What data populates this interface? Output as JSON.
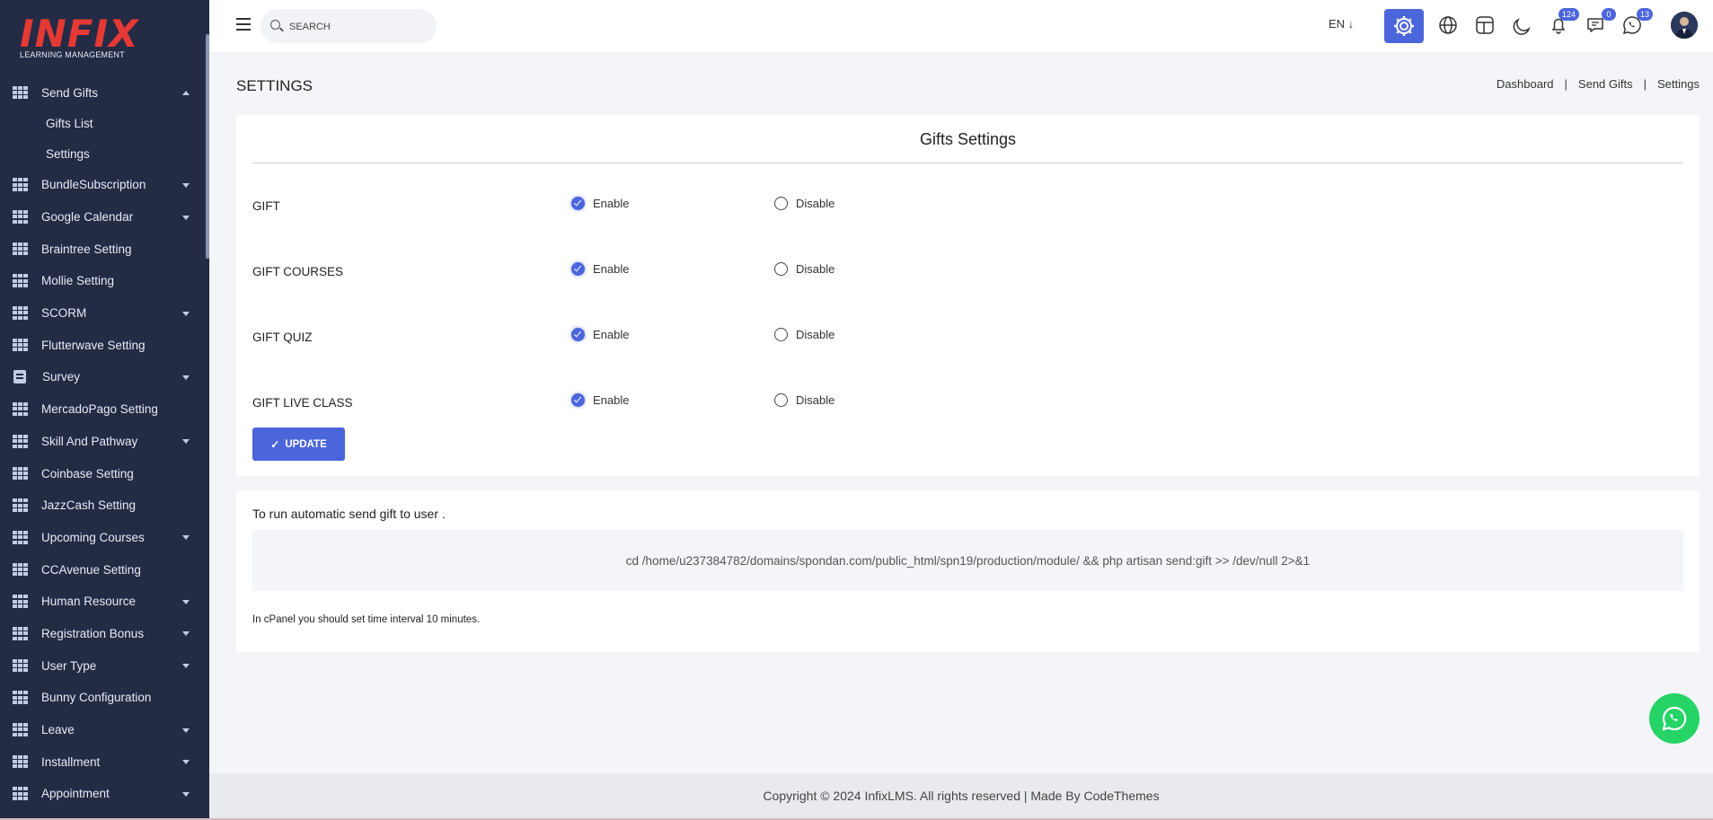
{
  "sidebar": {
    "logo_text": "INFIX",
    "logo_sub": "LEARNING MANAGEMENT",
    "active_group": "Send Gifts",
    "sub_items": [
      "Gifts List",
      "Settings"
    ],
    "items": [
      {
        "label": "BundleSubscription",
        "caret": true
      },
      {
        "label": "Google Calendar",
        "caret": true
      },
      {
        "label": "Braintree Setting",
        "caret": false
      },
      {
        "label": "Mollie Setting",
        "caret": false
      },
      {
        "label": "SCORM",
        "caret": true
      },
      {
        "label": "Flutterwave Setting",
        "caret": false
      },
      {
        "label": "Survey",
        "caret": true
      },
      {
        "label": "MercadoPago Setting",
        "caret": false
      },
      {
        "label": "Skill And Pathway",
        "caret": true
      },
      {
        "label": "Coinbase Setting",
        "caret": false
      },
      {
        "label": "JazzCash Setting",
        "caret": false
      },
      {
        "label": "Upcoming Courses",
        "caret": true
      },
      {
        "label": "CCAvenue Setting",
        "caret": false
      },
      {
        "label": "Human Resource",
        "caret": true
      },
      {
        "label": "Registration Bonus",
        "caret": true
      },
      {
        "label": "User Type",
        "caret": true
      },
      {
        "label": "Bunny Configuration",
        "caret": false
      },
      {
        "label": "Leave",
        "caret": true
      },
      {
        "label": "Installment",
        "caret": true
      },
      {
        "label": "Appointment",
        "caret": true
      }
    ]
  },
  "header": {
    "search_placeholder": "SEARCH",
    "language": "EN ↓",
    "badges": {
      "notifications": "124",
      "messages": "0",
      "whatsapp": "13"
    }
  },
  "page": {
    "title": "SETTINGS",
    "breadcrumb": [
      "Dashboard",
      "Send Gifts",
      "Settings"
    ]
  },
  "settings_card": {
    "title": "Gifts Settings",
    "enable_label": "Enable",
    "disable_label": "Disable",
    "rows": [
      {
        "label": "GIFT",
        "value": "Enable"
      },
      {
        "label": "GIFT COURSES",
        "value": "Enable"
      },
      {
        "label": "GIFT QUIZ",
        "value": "Enable"
      },
      {
        "label": "GIFT LIVE CLASS",
        "value": "Enable"
      }
    ],
    "update_label": "UPDATE"
  },
  "cron_card": {
    "title": "To run automatic send gift to user .",
    "command": "cd /home/u237384782/domains/spondan.com/public_html/spn19/production/module/ && php artisan send:gift >> /dev/null 2>&1",
    "note": "In cPanel you should set time interval 10 minutes."
  },
  "footer": {
    "text": "Copyright © 2024 InfixLMS. All rights reserved | Made By CodeThemes"
  },
  "colors": {
    "sidebar_bg": "#232b45",
    "accent": "#4b65db",
    "whatsapp": "#25d366",
    "logo_red": "#e53935"
  }
}
